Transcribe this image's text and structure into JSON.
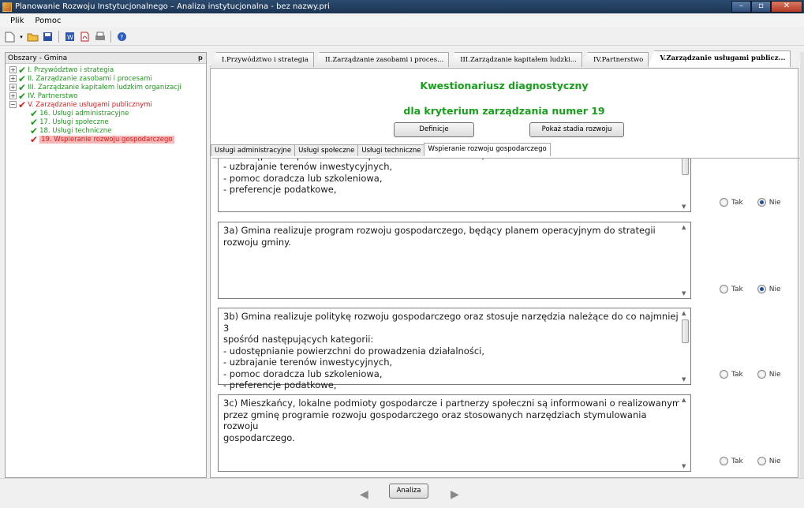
{
  "window": {
    "title": "Planowanie Rozwoju Instytucjonalnego – Analiza instytucjonalna - bez nazwy.pri",
    "min": "–",
    "max": "▫",
    "close": "✕"
  },
  "menu": [
    "Plik",
    "Pomoc"
  ],
  "toolbar_icons": [
    "new-file-icon",
    "open-folder-icon",
    "save-icon",
    "word-export-icon",
    "pdf-export-icon",
    "print-icon",
    "help-icon"
  ],
  "tree": {
    "header": "Obszary - Gmina",
    "pin": "ᵽ",
    "items": [
      {
        "label": "I. Przywództwo i strategia",
        "status": "green",
        "expander": "+"
      },
      {
        "label": "II. Zarządzanie zasobami i procesami",
        "status": "green",
        "expander": "+"
      },
      {
        "label": "III. Zarządzanie kapitałem ludzkim organizacji",
        "status": "green",
        "expander": "+"
      },
      {
        "label": "IV. Partnerstwo",
        "status": "green",
        "expander": "+"
      },
      {
        "label": "V. Zarządzanie usługami publicznymi",
        "status": "red",
        "expander": "−"
      }
    ],
    "children": [
      {
        "label": "16. Usługi administracyjne",
        "status": "green"
      },
      {
        "label": "17. Usługi społeczne",
        "status": "green"
      },
      {
        "label": "18. Usługi techniczne",
        "status": "green"
      },
      {
        "label": "19. Wspieranie rozwoju gospodarczego",
        "status": "red",
        "selected": true
      }
    ]
  },
  "tabs": [
    "I.Przywództwo i strategia",
    "II.Zarządzanie zasobami i proces...",
    "III.Zarządzanie kapitałem ludzki...",
    "IV.Partnerstwo",
    "V.Zarządzanie usługami publicz..."
  ],
  "questionnaire": {
    "title": "Kwestionariusz diagnostyczny",
    "subtitle": "dla kryterium zarządzania numer 19",
    "btn_definitions": "Definicje",
    "btn_stages": "Pokaż stadia rozwoju"
  },
  "subtabs": [
    "Usługi administracyjne",
    "Usługi społeczne",
    "Usługi techniczne",
    "Wspieranie rozwoju gospodarczego"
  ],
  "questions": [
    {
      "text": "spośród następujących kategorii:\n- udostępnianie powierzchni do prowadzenia działalności,\n- uzbrajanie terenów inwestycyjnych,\n- pomoc doradcza lub szkoleniowa,\n- preferencje podatkowe,",
      "tak": "Tak",
      "nie": "Nie",
      "answer": "nie"
    },
    {
      "text": "3a) Gmina realizuje program rozwoju gospodarczego, będący planem operacyjnym do strategii\nrozwoju gminy.",
      "tak": "Tak",
      "nie": "Nie",
      "answer": "nie"
    },
    {
      "text": "3b) Gmina realizuje politykę rozwoju gospodarczego oraz stosuje narzędzia należące do co najmniej 3\nspośród następujących kategorii:\n- udostępnianie powierzchni do prowadzenia działalności,\n- uzbrajanie terenów inwestycyjnych,\n- pomoc doradcza lub szkoleniowa,\n- preferencje podatkowe,",
      "tak": "Tak",
      "nie": "Nie",
      "answer": ""
    },
    {
      "text": "3c) Mieszkańcy, lokalne podmioty gospodarcze i partnerzy społeczni są informowani o realizowanym\nprzez gminę programie rozwoju gospodarczego oraz stosowanych narzędziach stymulowania rozwoju\ngospodarczego.",
      "tak": "Tak",
      "nie": "Nie",
      "answer": ""
    }
  ],
  "bottom": {
    "analiza": "Analiza",
    "prev": "◀",
    "next": "▶"
  }
}
